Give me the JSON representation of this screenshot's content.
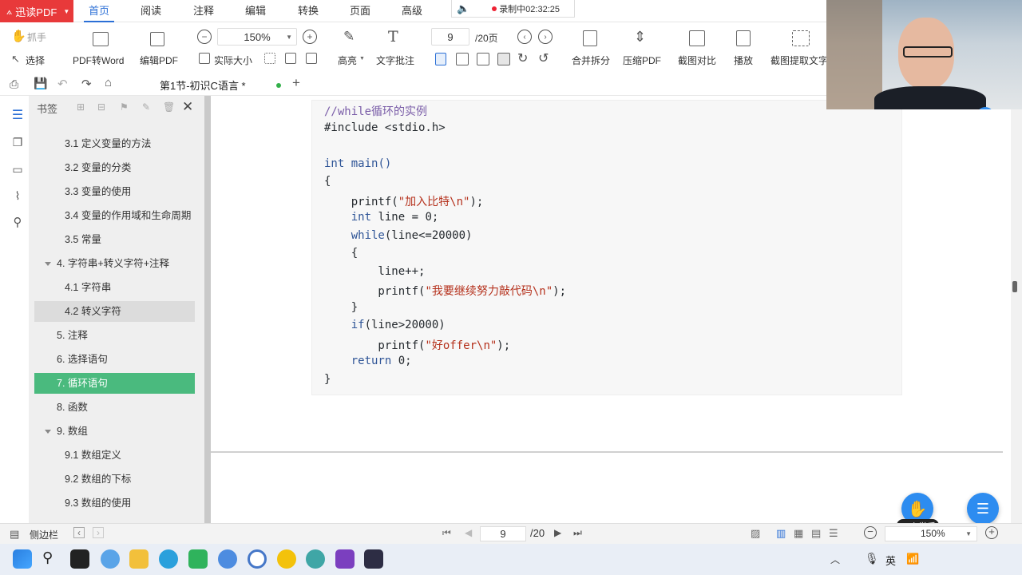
{
  "app": {
    "brand": "迅读PDF"
  },
  "menu": {
    "items": [
      "首页",
      "阅读",
      "注释",
      "编辑",
      "转换",
      "页面",
      "高级"
    ],
    "active_index": 0,
    "recording": "录制中02:32:25"
  },
  "toolbar": {
    "hand_label": "抓手",
    "select_label": "选择",
    "pdf_to_word": "PDF转Word",
    "edit_pdf": "编辑PDF",
    "zoom_value": "150%",
    "actual_size": "实际大小",
    "highlight": "高亮",
    "text_note": "文字批注",
    "page_current": "9",
    "page_total": "/20页",
    "merge_split": "合并拆分",
    "compress_pdf": "压缩PDF",
    "screenshot_compare": "截图对比",
    "play": "播放",
    "screenshot_ocr": "截图提取文字"
  },
  "tab": {
    "title": "第1节-初识C语言 *",
    "add": "+"
  },
  "bookmarks": {
    "header": "书签",
    "items": [
      {
        "label": "3.1 定义变量的方法",
        "level": 2,
        "state": "normal"
      },
      {
        "label": "3.2 变量的分类",
        "level": 2,
        "state": "normal"
      },
      {
        "label": "3.3 变量的使用",
        "level": 2,
        "state": "normal"
      },
      {
        "label": "3.4 变量的作用域和生命周期",
        "level": 2,
        "state": "normal"
      },
      {
        "label": "3.5 常量",
        "level": 2,
        "state": "normal"
      },
      {
        "label": "4. 字符串+转义字符+注释",
        "level": 1,
        "state": "expanded"
      },
      {
        "label": "4.1 字符串",
        "level": 2,
        "state": "normal"
      },
      {
        "label": "4.2 转义字符",
        "level": 2,
        "state": "selected"
      },
      {
        "label": "5. 注释",
        "level": 1,
        "state": "normal"
      },
      {
        "label": "6. 选择语句",
        "level": 1,
        "state": "normal"
      },
      {
        "label": "7. 循环语句",
        "level": 1,
        "state": "active"
      },
      {
        "label": "8. 函数",
        "level": 1,
        "state": "normal"
      },
      {
        "label": "9. 数组",
        "level": 1,
        "state": "expanded"
      },
      {
        "label": "9.1 数组定义",
        "level": 2,
        "state": "normal"
      },
      {
        "label": "9.2 数组的下标",
        "level": 2,
        "state": "normal"
      },
      {
        "label": "9.3 数组的使用",
        "level": 2,
        "state": "normal"
      }
    ]
  },
  "code": {
    "comment": "//while循环的实例",
    "include": "#include <stdio.h>",
    "kw_int": "int",
    "main_sig": " main()",
    "open_brace": "{",
    "printf1_pre": "    printf(",
    "printf1_str": "\"加入比特\\n\"",
    "printf1_post": ");",
    "line_decl_kw": "    int",
    "line_decl_rest": " line = 0;",
    "while_kw": "    while",
    "while_rest": "(line<=20000)",
    "while_open": "    {",
    "incr": "        line++;",
    "printf2_pre": "        printf(",
    "printf2_str": "\"我要继续努力敲代码\\n\"",
    "printf2_post": ");",
    "while_close": "    }",
    "if_kw": "    if",
    "if_rest": "(line>20000)",
    "printf3_pre": "        printf(",
    "printf3_str": "\"好offer\\n\"",
    "printf3_post": ");",
    "return_kw": "    return",
    "return_rest": " 0;",
    "close_brace": "}"
  },
  "statusbar": {
    "sidebar_label": "侧边栏",
    "page_current": "9",
    "page_total": "/20",
    "zoom_value": "150%"
  },
  "overlay": {
    "raise_hand": "30人举手"
  },
  "taskbar": {
    "ime_lang": "英"
  },
  "colors": {
    "accent": "#2b6fd6",
    "active_bookmark": "#4aba7e",
    "brand_red": "#e8393a"
  }
}
